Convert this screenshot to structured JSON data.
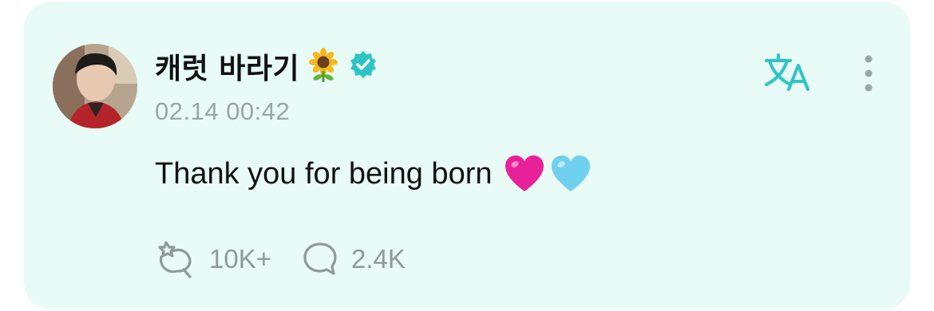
{
  "post": {
    "author_name": "캐럿 바라기",
    "author_emoji": "sunflower-emoji",
    "verified_icon": "verified-badge-icon",
    "timestamp": "02.14 00:42",
    "text": "Thank you for being born",
    "text_emojis": [
      "pink-heart-emoji",
      "light-blue-heart-emoji"
    ]
  },
  "header_actions": {
    "translate_icon": "translate-icon",
    "more_icon": "more-vertical-icon"
  },
  "stats": {
    "likes_icon": "fan-reaction-icon",
    "likes_count": "10K+",
    "comments_icon": "comment-bubble-icon",
    "comments_count": "2.4K"
  },
  "colors": {
    "card_background": "#e8fbf6",
    "accent": "#2ec4c6",
    "muted_text": "#9aa5a5",
    "pink_heart": "#e8219a",
    "blue_heart": "#6fd0f0"
  }
}
